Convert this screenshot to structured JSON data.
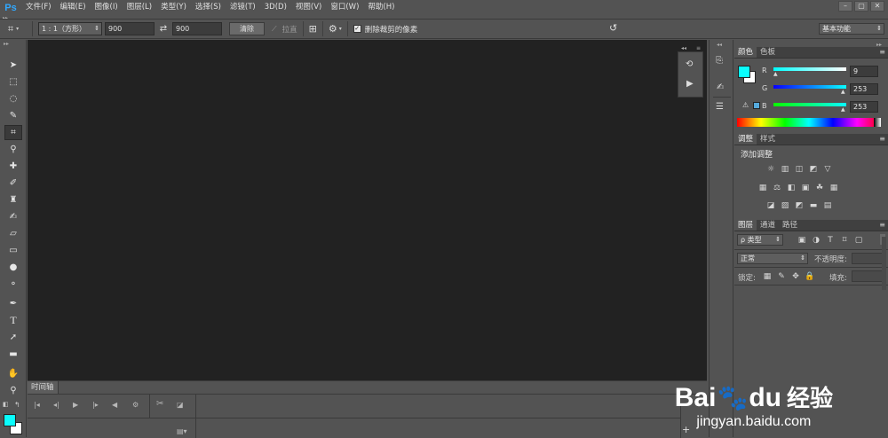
{
  "app": {
    "logo": "Ps",
    "menu": [
      "文件(F)",
      "编辑(E)",
      "图像(I)",
      "图层(L)",
      "类型(Y)",
      "选择(S)",
      "滤镜(T)",
      "3D(D)",
      "视图(V)",
      "窗口(W)",
      "帮助(H)"
    ],
    "window_controls": [
      "–",
      "▢",
      "✕"
    ]
  },
  "options": {
    "ratio": "1 : 1（方形）",
    "width": "900",
    "height": "900",
    "clear_label": "清除",
    "straighten_label": "拉直",
    "delete_cropped_label": "删除裁剪的像素",
    "delete_cropped_checked": true,
    "workspace": "基本功能"
  },
  "timeline": {
    "tab_label": "时间轴"
  },
  "color_panel": {
    "tabs": [
      "颜色",
      "色板"
    ],
    "foreground": "#0afdfd",
    "background": "#ffffff",
    "r_label": "R",
    "r_value": "9",
    "g_label": "G",
    "g_value": "253",
    "b_label": "B",
    "b_value": "253"
  },
  "adjust_panel": {
    "tabs": [
      "调整",
      "样式"
    ],
    "title": "添加调整"
  },
  "layers_panel": {
    "tabs": [
      "图层",
      "通道",
      "路径"
    ],
    "filter_kind": "ρ 类型",
    "blend_mode": "正常",
    "opacity_label": "不透明度:",
    "lock_label": "锁定:",
    "fill_label": "填充:"
  },
  "watermark": {
    "brand_1": "Bai",
    "brand_2": "du",
    "brand_3": "经验",
    "url": "jingyan.baidu.com"
  }
}
